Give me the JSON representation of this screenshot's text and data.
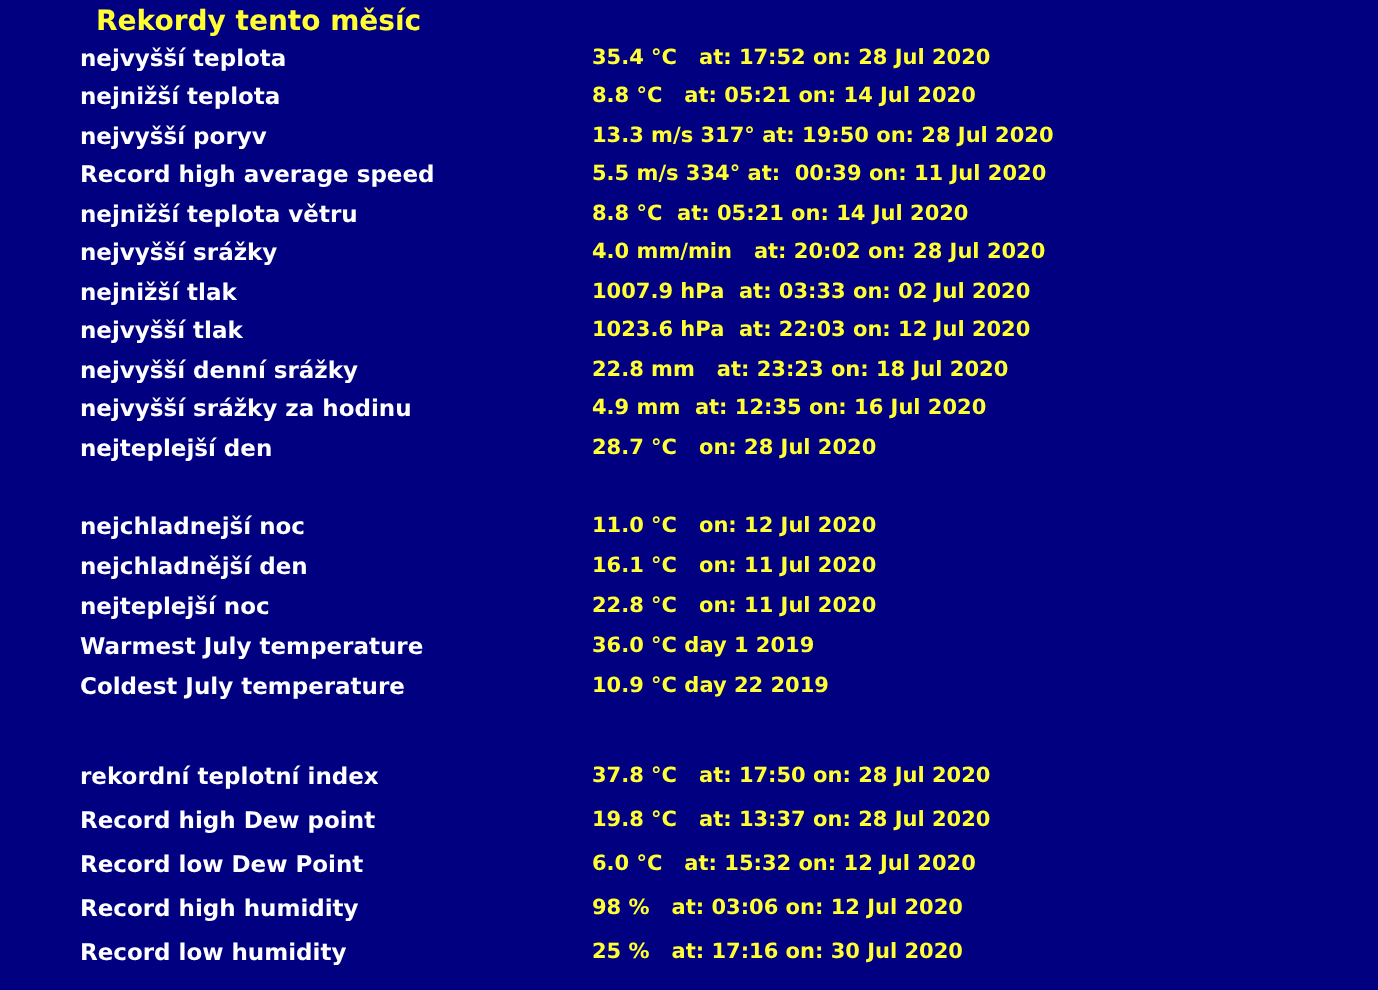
{
  "title": "Rekordy tento měsíc",
  "sections": [
    {
      "rows": [
        {
          "label": "nejvyšší teplota",
          "value": "35.4 °C   at: 17:52 on: 28 Jul 2020"
        },
        {
          "label": "nejnižší teplota",
          "value": "8.8 °C   at: 05:21 on: 14 Jul 2020"
        },
        {
          "label": "nejvyšší poryv",
          "value": "13.3 m/s 317° at: 19:50 on: 28 Jul 2020"
        },
        {
          "label": "Record high average speed",
          "value": "5.5 m/s 334° at:  00:39 on: 11 Jul 2020"
        },
        {
          "label": "nejnižší teplota větru",
          "value": "8.8 °C  at: 05:21 on: 14 Jul 2020"
        },
        {
          "label": "nejvyšší srážky",
          "value": "4.0 mm/min   at: 20:02 on: 28 Jul 2020"
        },
        {
          "label": "nejnižší tlak",
          "value": "1007.9 hPa  at: 03:33 on: 02 Jul 2020"
        },
        {
          "label": "nejvyšší tlak",
          "value": "1023.6 hPa  at: 22:03 on: 12 Jul 2020"
        },
        {
          "label": "nejvyšší denní srážky",
          "value": "22.8 mm   at: 23:23 on: 18 Jul 2020"
        },
        {
          "label": "nejvyšší srážky za hodinu",
          "value": "4.9 mm  at: 12:35 on: 16 Jul 2020"
        },
        {
          "label": "nejteplejší den",
          "value": "28.7 °C   on: 28 Jul 2020"
        }
      ]
    },
    {
      "rows": [
        {
          "label": "nejchladnejší noc",
          "value": "11.0 °C   on: 12 Jul 2020"
        },
        {
          "label": "nejchladnější den",
          "value": "16.1 °C   on: 11 Jul 2020"
        },
        {
          "label": "nejteplejší noc",
          "value": "22.8 °C   on: 11 Jul 2020"
        },
        {
          "label": "Warmest July temperature",
          "value": "36.0 °C day 1 2019"
        },
        {
          "label": "Coldest July temperature",
          "value": "10.9 °C day 22 2019"
        }
      ]
    },
    {
      "rows": [
        {
          "label": "rekordní teplotní index",
          "value": "37.8 °C   at: 17:50 on: 28 Jul 2020"
        },
        {
          "label": "Record high Dew point",
          "value": "19.8 °C   at: 13:37 on: 28 Jul 2020"
        },
        {
          "label": "Record low Dew Point",
          "value": "6.0 °C   at: 15:32 on: 12 Jul 2020"
        },
        {
          "label": "Record high humidity",
          "value": "98 %   at: 03:06 on: 12 Jul 2020"
        },
        {
          "label": "Record low humidity",
          "value": "25 %   at: 17:16 on: 30 Jul 2020"
        }
      ]
    }
  ]
}
